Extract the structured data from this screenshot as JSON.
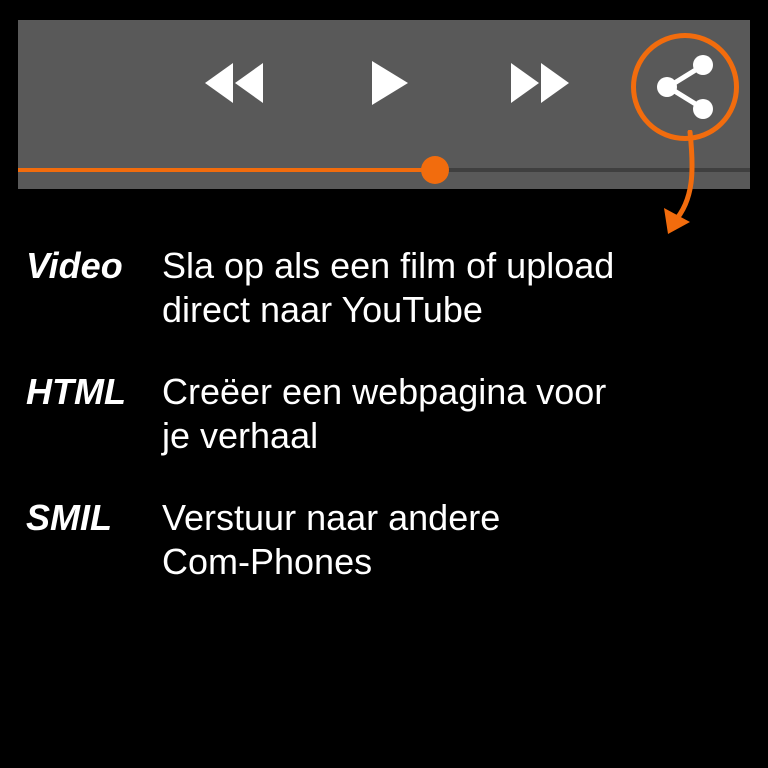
{
  "player": {
    "controls": [
      {
        "name": "rewind",
        "icon": "rewind-icon"
      },
      {
        "name": "play",
        "icon": "play-icon"
      },
      {
        "name": "fast-forward",
        "icon": "fast-forward-icon"
      }
    ],
    "share": {
      "icon": "share-icon"
    },
    "progress": 0.57
  },
  "colors": {
    "accent": "#f26c0d",
    "player_bg": "#595959",
    "background": "#000000",
    "text": "#ffffff",
    "icon": "#ffffff"
  },
  "legend": [
    {
      "term": "Video",
      "lines": [
        "Sla op als een film of upload",
        "direct naar YouTube"
      ]
    },
    {
      "term": "HTML",
      "lines": [
        "Creëer een webpagina voor",
        "je verhaal"
      ]
    },
    {
      "term": "SMIL",
      "lines": [
        "Verstuur naar andere",
        "Com-Phones"
      ]
    }
  ]
}
